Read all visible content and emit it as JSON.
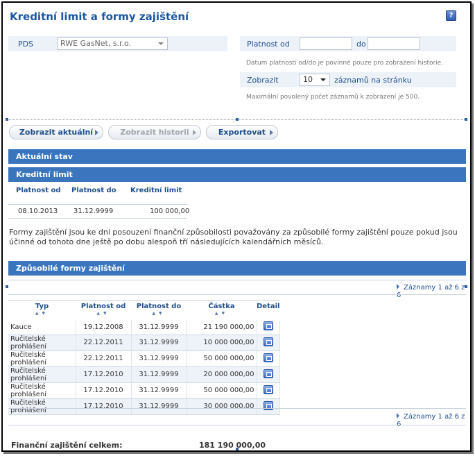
{
  "page": {
    "title": "Kreditní limit a formy zajištění",
    "help_icon": "question-icon"
  },
  "filters": {
    "pds_label": "PDS",
    "pds_value": "RWE GasNet, s.r.o.",
    "valid_from_label": "Platnost od",
    "valid_from_value": "",
    "valid_to_label": "do",
    "valid_to_value": "",
    "date_note": "Datum platnosti od/do je povinné pouze pro zobrazení historie.",
    "show_label": "Zobrazit",
    "show_value": "10",
    "show_suffix": "záznamů na stránku",
    "max_note": "Maximální povolený počet záznamů k zobrazení je 500."
  },
  "buttons": {
    "show_current": "Zobrazit aktuální",
    "show_history": "Zobrazit historii",
    "export": "Exportovat"
  },
  "sections": {
    "current_state": "Aktuální stav",
    "credit_limit": "Kreditní limit",
    "eligible_forms": "Způsobilé formy zajištění"
  },
  "credit_limit_table": {
    "headers": [
      "Platnost od",
      "Platnost do",
      "Kreditní limit"
    ],
    "row": [
      "08.10.2013",
      "31.12.9999",
      "100 000,00"
    ]
  },
  "paragraph": "Formy zajištění jsou ke dni posouzení finanční způsobilosti považovány za způsobilé formy zajištění pouze pokud jsou účinné od tohoto dne ještě po dobu alespoň tří následujících kalendářních měsíců.",
  "pager": {
    "text": "Záznamy 1 až 6 z 6"
  },
  "forms_table": {
    "headers": [
      "Typ",
      "Platnost od",
      "Platnost do",
      "Částka",
      "Detail"
    ],
    "rows": [
      [
        "Kauce",
        "19.12.2008",
        "31.12.9999",
        "21 190 000,00"
      ],
      [
        "Ručitelské prohlášení",
        "22.12.2011",
        "31.12.9999",
        "10 000 000,00"
      ],
      [
        "Ručitelské prohlášení",
        "22.12.2011",
        "31.12.9999",
        "50 000 000,00"
      ],
      [
        "Ručitelské prohlášení",
        "17.12.2010",
        "31.12.9999",
        "20 000 000,00"
      ],
      [
        "Ručitelské prohlášení",
        "17.12.2010",
        "31.12.9999",
        "50 000 000,00"
      ],
      [
        "Ručitelské prohlášení",
        "17.12.2010",
        "31.12.9999",
        "30 000 000,00"
      ]
    ]
  },
  "total": {
    "label": "Finanční zajištění celkem:",
    "value": "181 190 000,00"
  }
}
